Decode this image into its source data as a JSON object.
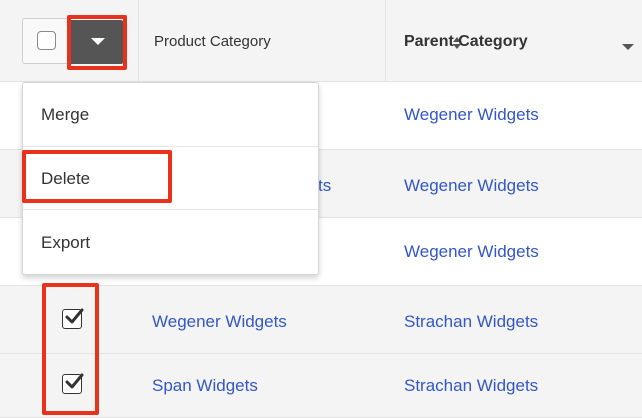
{
  "header": {
    "col_product": "Product Category",
    "col_parent": "Parent Category"
  },
  "menu": {
    "items": [
      {
        "label": "Merge"
      },
      {
        "label": "Delete"
      },
      {
        "label": "Export"
      }
    ]
  },
  "rows": [
    {
      "name": "",
      "partial_name": "",
      "parent": "Wegener Widgets",
      "checked": false
    },
    {
      "name": "",
      "partial_name": "ts",
      "parent": "Wegener Widgets",
      "checked": false
    },
    {
      "name": "",
      "partial_name": "",
      "parent": "Wegener Widgets",
      "checked": false
    },
    {
      "name": "Wegener Widgets",
      "partial_name": "",
      "parent": "Strachan Widgets",
      "checked": true
    },
    {
      "name": "Span Widgets",
      "partial_name": "",
      "parent": "Strachan Widgets",
      "checked": true
    }
  ],
  "colors": {
    "link": "#3357c8",
    "annotation": "#e8321c",
    "header_bg": "#f4f4f4",
    "dropdown_btn": "#555555"
  }
}
